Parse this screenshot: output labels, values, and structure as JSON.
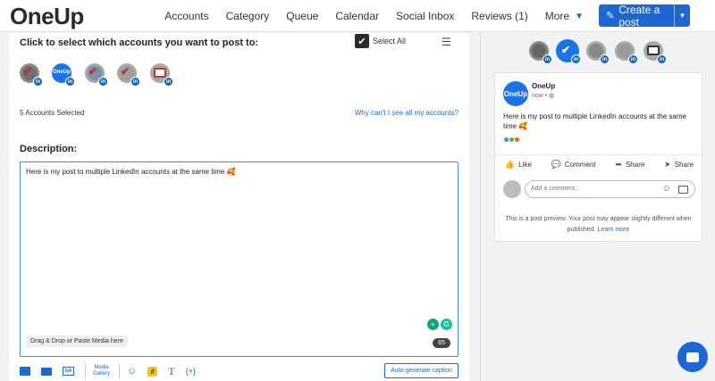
{
  "brand": {
    "logo": "OneUp",
    "accent": "#1d67d3"
  },
  "nav": {
    "items": [
      "Accounts",
      "Category",
      "Queue",
      "Calendar",
      "Social Inbox",
      "Reviews (1)"
    ],
    "more_label": "More",
    "create_label": "Create a post"
  },
  "accounts": {
    "title": "Click to select which accounts you want to post to:",
    "select_all_label": "Select All",
    "select_all_checked": true,
    "selected_text": "5 Accounts Selected",
    "why_link": "Why can't I see all my accounts?",
    "items": [
      {
        "icon": "linkedin-badge-icon"
      },
      {
        "icon": "linkedin-badge-icon"
      },
      {
        "icon": "linkedin-badge-icon"
      },
      {
        "icon": "linkedin-badge-icon"
      },
      {
        "icon": "linkedin-badge-icon"
      }
    ]
  },
  "description": {
    "label": "Description:",
    "text": "Here is my post to multiple LinkedIn accounts at the same time 🥰",
    "drag_hint": "Drag & Drop or Paste Media here",
    "char_count": "65"
  },
  "toolbar": {
    "gif_label": "GIF",
    "media_gallery_label_1": "Media",
    "media_gallery_label_2": "Gallery",
    "hashtag_label": "#",
    "text_label": "T",
    "variable_label": "{+}",
    "auto_generate_label": "Auto-generate caption"
  },
  "preview": {
    "account_name": "OneUp",
    "logo_text": "OneUp",
    "time": "now",
    "text": "Here is my post to multiple LinkedIn accounts at the same time 🥰",
    "actions": [
      "Like",
      "Comment",
      "Share",
      "Share"
    ],
    "comment_placeholder": "Add a comment...",
    "note": "This is a post preview. Your post may appear slightly different when published.",
    "learn_more": "Learn more"
  }
}
